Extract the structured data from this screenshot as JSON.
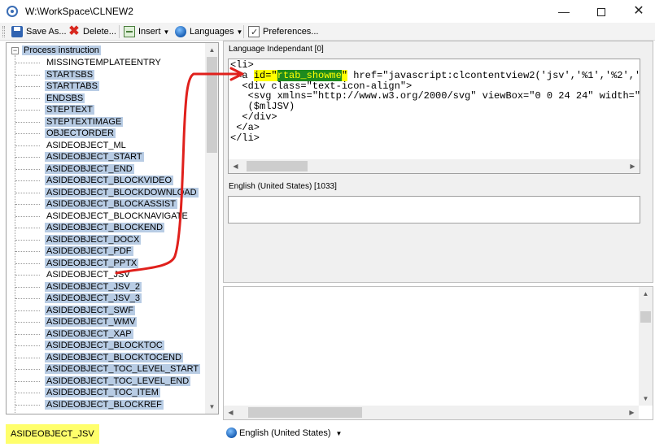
{
  "window": {
    "title": "W:\\WorkSpace\\CLNEW2",
    "minimize_glyph": "—",
    "close_glyph": "✕"
  },
  "toolbar": {
    "save_as_label": "Save As...",
    "delete_label": "Delete...",
    "insert_label": "Insert",
    "languages_label": "Languages",
    "preferences_label": "Preferences...",
    "dropdown_caret": "▼"
  },
  "tree": {
    "root_label": "Process instruction",
    "root_toggle": "−",
    "items": [
      {
        "label": "MISSINGTEMPLATEENTRY",
        "selected": false
      },
      {
        "label": "STARTSBS",
        "selected": true
      },
      {
        "label": "STARTTABS",
        "selected": true
      },
      {
        "label": "ENDSBS",
        "selected": true
      },
      {
        "label": "STEPTEXT",
        "selected": true
      },
      {
        "label": "STEPTEXTIMAGE",
        "selected": true
      },
      {
        "label": "OBJECTORDER",
        "selected": true
      },
      {
        "label": "ASIDEOBJECT_ML",
        "selected": false
      },
      {
        "label": "ASIDEOBJECT_START",
        "selected": true
      },
      {
        "label": "ASIDEOBJECT_END",
        "selected": true
      },
      {
        "label": "ASIDEOBJECT_BLOCKVIDEO",
        "selected": true
      },
      {
        "label": "ASIDEOBJECT_BLOCKDOWNLOAD",
        "selected": true
      },
      {
        "label": "ASIDEOBJECT_BLOCKASSIST",
        "selected": true
      },
      {
        "label": "ASIDEOBJECT_BLOCKNAVIGATE",
        "selected": false
      },
      {
        "label": "ASIDEOBJECT_BLOCKEND",
        "selected": true
      },
      {
        "label": "ASIDEOBJECT_DOCX",
        "selected": true
      },
      {
        "label": "ASIDEOBJECT_PDF",
        "selected": true
      },
      {
        "label": "ASIDEOBJECT_PPTX",
        "selected": true
      },
      {
        "label": "ASIDEOBJECT_JSV",
        "selected": false
      },
      {
        "label": "ASIDEOBJECT_JSV_2",
        "selected": true
      },
      {
        "label": "ASIDEOBJECT_JSV_3",
        "selected": true
      },
      {
        "label": "ASIDEOBJECT_SWF",
        "selected": true
      },
      {
        "label": "ASIDEOBJECT_WMV",
        "selected": true
      },
      {
        "label": "ASIDEOBJECT_XAP",
        "selected": true
      },
      {
        "label": "ASIDEOBJECT_BLOCKTOC",
        "selected": true
      },
      {
        "label": "ASIDEOBJECT_BLOCKTOCEND",
        "selected": true
      },
      {
        "label": "ASIDEOBJECT_TOC_LEVEL_START",
        "selected": true
      },
      {
        "label": "ASIDEOBJECT_TOC_LEVEL_END",
        "selected": true
      },
      {
        "label": "ASIDEOBJECT_TOC_ITEM",
        "selected": true
      },
      {
        "label": "ASIDEOBJECT_BLOCKREF",
        "selected": true
      }
    ]
  },
  "status": {
    "selected_item": "ASIDEOBJECT_JSV",
    "language": "English (United States)",
    "language_caret": "▼"
  },
  "editor": {
    "section1_label": "Language Independant [0]",
    "section2_label": "English (United States) [1033]",
    "code_lines": {
      "l1": "<li>",
      "l2_pre": " <a ",
      "l2_attr": "id=\"",
      "l2_val": "rtab_showme",
      "l2_attr_end": "\"",
      "l2_post": " href=\"javascript:clcontentview2('jsv','%1','%2','",
      "l3": "  <div class=\"text-icon-align\">",
      "l4": "   <svg xmlns=\"http://www.w3.org/2000/svg\" viewBox=\"0 0 24 24\" width=\"",
      "l5": "   ($mlJSV)",
      "l6": "  </div>",
      "l7": " </a>",
      "l8": "</li>"
    }
  },
  "scroll": {
    "up": "▲",
    "down": "▼",
    "left": "◀",
    "right": "▶"
  },
  "colors": {
    "annotation_red": "#e0201c",
    "highlight_yellow": "#ffff6b",
    "selection_blue": "#b8cce4"
  }
}
